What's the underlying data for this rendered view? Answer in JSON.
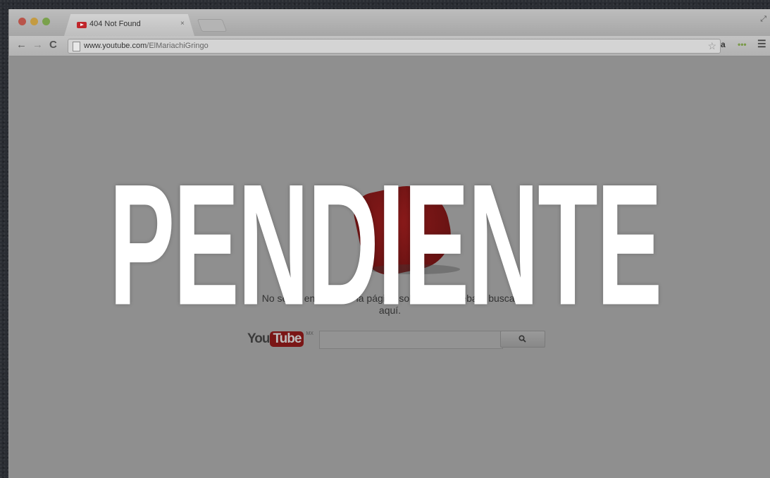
{
  "browser": {
    "tab": {
      "title": "404 Not Found",
      "close": "×"
    },
    "address_bar": {
      "domain": "www.youtube.com",
      "path": "/ElMariachiGringo"
    },
    "extensions": {
      "amazon": "a",
      "dots": "•••"
    }
  },
  "page": {
    "message_line1": "No se ha encontrado la página solicitada. Prueba a buscar",
    "message_line2": "aquí.",
    "logo": {
      "you": "You",
      "tube": "Tube",
      "country": "MX"
    },
    "search_placeholder": ""
  },
  "overlay": {
    "text": "PENDIENTE"
  },
  "colors": {
    "overlay_text": "#ffffff",
    "youtube_red": "#c0262b",
    "page_bg": "#8f8f8f"
  },
  "icons": [
    "back-arrow-icon",
    "forward-arrow-icon",
    "reload-icon",
    "page-icon",
    "star-icon",
    "menu-icon",
    "search-icon",
    "youtube-favicon-icon",
    "fullscreen-icon"
  ]
}
